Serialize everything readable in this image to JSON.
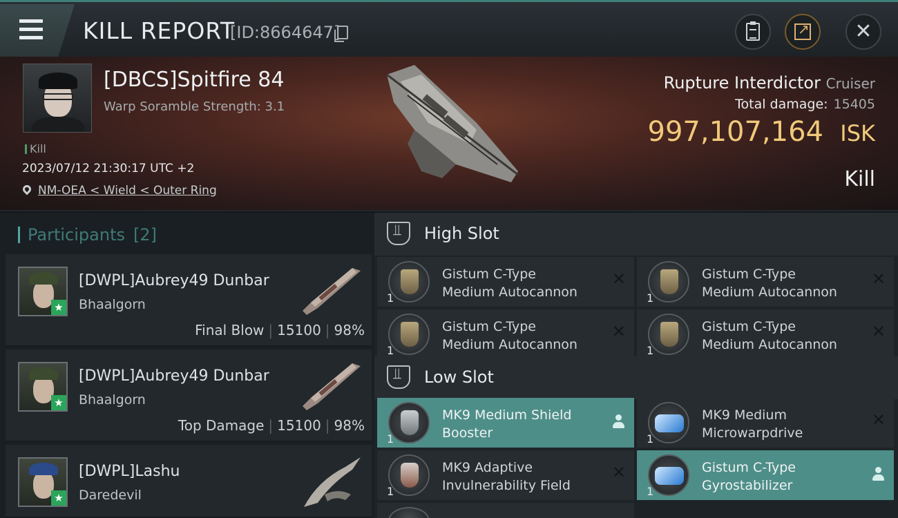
{
  "header": {
    "title": "KILL REPORT",
    "report_id": "[ID:8664647]"
  },
  "victim": {
    "name": "[DBCS]Spitfire 84",
    "subtitle": "Warp Soramble Strength: 3.1",
    "kill_tag": "Kill",
    "datetime": "2023/07/12 21:30:17 UTC +2",
    "location": "NM-OEA < Wield < Outer Ring",
    "ship_name": "Rupture Interdictor",
    "ship_class": "Cruiser",
    "total_damage_label": "Total damage:",
    "total_damage": "15405",
    "isk_value": "997,107,164",
    "isk_unit": "ISK",
    "result_label": "Kill"
  },
  "participants": {
    "label": "Participants",
    "count": "[2]",
    "items": [
      {
        "name": "[DWPL]Aubrey49 Dunbar",
        "ship": "Bhaalgorn",
        "role": "Final Blow",
        "damage": "15100",
        "percent": "98%"
      },
      {
        "name": "[DWPL]Aubrey49 Dunbar",
        "ship": "Bhaalgorn",
        "role": "Top Damage",
        "damage": "15100",
        "percent": "98%"
      },
      {
        "name": "[DWPL]Lashu",
        "ship": "Daredevil"
      }
    ]
  },
  "fitting": {
    "high_slot_label": "High Slot",
    "low_slot_label": "Low Slot",
    "high": [
      {
        "name1": "Gistum C-Type",
        "name2": "Medium Autocannon",
        "qty": "1"
      },
      {
        "name1": "Gistum C-Type",
        "name2": "Medium Autocannon",
        "qty": "1"
      },
      {
        "name1": "Gistum C-Type",
        "name2": "Medium Autocannon",
        "qty": "1"
      },
      {
        "name1": "Gistum C-Type",
        "name2": "Medium Autocannon",
        "qty": "1"
      }
    ],
    "low": [
      {
        "name1": "MK9 Medium Shield",
        "name2": "Booster",
        "qty": "1"
      },
      {
        "name1": "MK9 Medium",
        "name2": "Microwarpdrive",
        "qty": "1"
      },
      {
        "name1": "MK9 Adaptive",
        "name2": "Invulnerability Field",
        "qty": "1"
      },
      {
        "name1": "Gistum C-Type",
        "name2": "Gyrostabilizer",
        "qty": "1"
      }
    ]
  },
  "colors": {
    "accent": "#4e8e88",
    "isk": "#f1c97a",
    "star": "#2aa55a"
  }
}
